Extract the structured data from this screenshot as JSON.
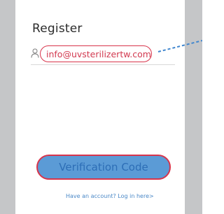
{
  "page": {
    "title": "Register"
  },
  "email_field": {
    "value": "info@uvsterilizertw.com",
    "icon": "user-icon"
  },
  "verify_button": {
    "label": "Verification Code"
  },
  "login_link": {
    "text": "Have an account? Log in here>"
  },
  "colors": {
    "highlight_red": "#d8344b",
    "button_blue": "#5b9bd6",
    "link_blue": "#4a88c7",
    "side_gray": "#c5c6c8"
  }
}
